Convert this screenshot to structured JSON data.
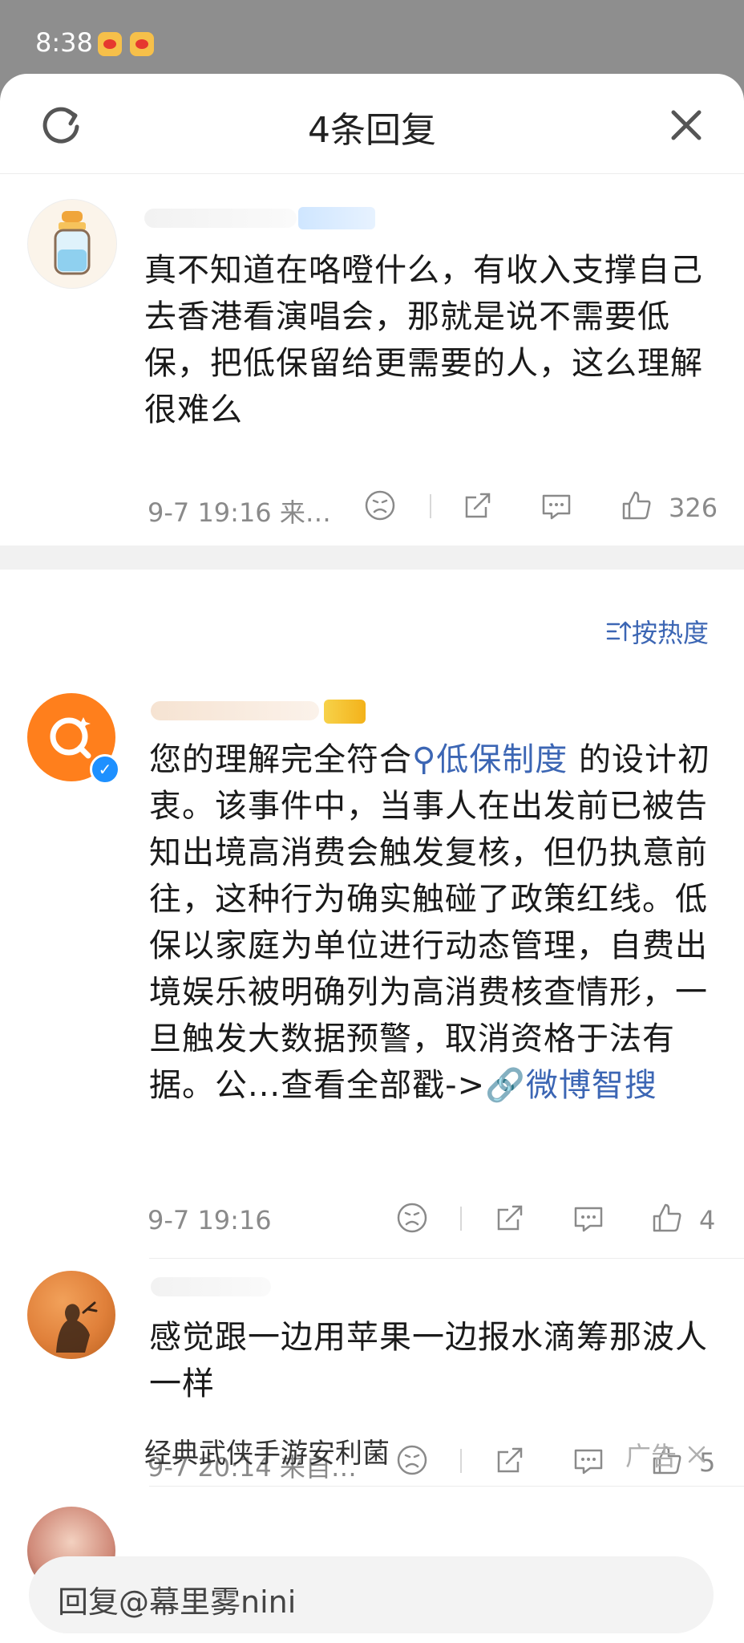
{
  "status_bar": {
    "time": "8:38",
    "app_icons": [
      "weibo-app-icon",
      "weibo-app-icon"
    ]
  },
  "header": {
    "title": "4条回复",
    "refresh_icon": "refresh-icon",
    "close_icon": "close-icon"
  },
  "main_comment": {
    "text": "真不知道在咯噔什么，有收入支撑自己去香港看演唱会，那就是说不需要低保，把低保留给更需要的人，这么理解很难么",
    "time": "9-7 19:16",
    "source": "来…",
    "likes": "326"
  },
  "sort": {
    "label": "按热度",
    "icon": "sort-icon"
  },
  "replies": [
    {
      "text_prefix": "您的理解完全符合",
      "link_text": "低保制度",
      "text_body": " 的设计初衷。该事件中，当事人在出发前已被告知出境高消费会触发复核，但仍执意前往，这种行为确实触碰了政策红线。低保以家庭为单位进行动态管理，自费出境娱乐被明确列为高消费核查情形，一旦触发大数据预警，取消资格于法有据。公...查看全部戳->",
      "link_tail": "微博智搜",
      "time": "9-7 19:16",
      "likes": "4"
    },
    {
      "text": "感觉跟一边用苹果一边报水滴筹那波人一样",
      "time": "9-7 20:14",
      "source": "来自…",
      "likes": "5"
    }
  ],
  "ad": {
    "title": "经典武侠手游安利菌",
    "tag": "广告"
  },
  "reply_bar": {
    "placeholder": "回复@幕里雾nini"
  },
  "colors": {
    "link": "#3c66b4",
    "meta": "#8a8a8a",
    "avatar_orange": "#ff7f1c",
    "verified_blue": "#1e90ff"
  }
}
